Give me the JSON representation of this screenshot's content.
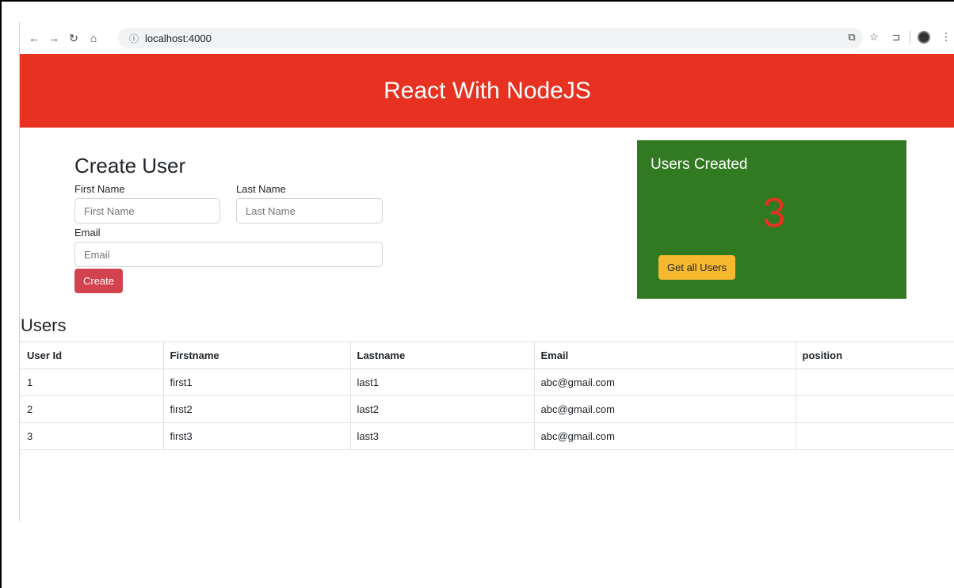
{
  "browser": {
    "url": "localhost:4000"
  },
  "header": {
    "title": "React With NodeJS"
  },
  "create_user": {
    "title": "Create User",
    "first_name_label": "First Name",
    "first_name_placeholder": "First Name",
    "last_name_label": "Last Name",
    "last_name_placeholder": "Last Name",
    "email_label": "Email",
    "email_placeholder": "Email",
    "create_button": "Create"
  },
  "summary": {
    "title": "Users Created",
    "count": "3",
    "get_all_button": "Get all Users"
  },
  "users": {
    "title": "Users",
    "columns": [
      "User Id",
      "Firstname",
      "Lastname",
      "Email",
      "position"
    ],
    "rows": [
      [
        "1",
        "first1",
        "last1",
        "abc@gmail.com",
        ""
      ],
      [
        "2",
        "first2",
        "last2",
        "abc@gmail.com",
        ""
      ],
      [
        "3",
        "first3",
        "last3",
        "abc@gmail.com",
        ""
      ]
    ]
  },
  "colors": {
    "header": "#e73222",
    "card": "#327a21",
    "create_button": "#d3434f",
    "get_button": "#f5b82e"
  }
}
